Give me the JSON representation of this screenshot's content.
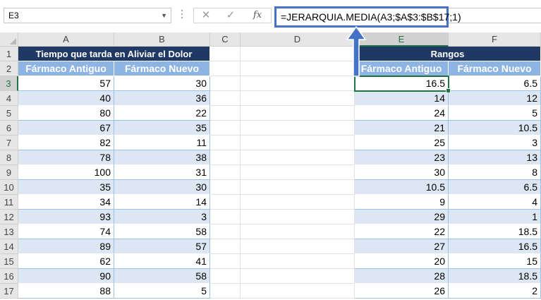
{
  "name_box": "E3",
  "formula": "=JERARQUIA.MEDIA(A3;$A$3:$B$17;1)",
  "formula_bar_icons": [
    "cancel-icon",
    "check-icon",
    "fx-icon"
  ],
  "fx_label": "fx",
  "cancel_glyph": "✕",
  "check_glyph": "✓",
  "columns": [
    "A",
    "B",
    "C",
    "D",
    "E",
    "F"
  ],
  "rows": [
    "1",
    "2",
    "3",
    "4",
    "5",
    "6",
    "7",
    "8",
    "9",
    "10",
    "11",
    "12",
    "13",
    "14",
    "15",
    "16",
    "17"
  ],
  "selected_cell": "E3",
  "left_table": {
    "title": "Tiempo que tarda en Aliviar el Dolor",
    "headers": [
      "Fármaco Antiguo",
      "Fármaco Nuevo"
    ],
    "rows": [
      [
        "57",
        "30"
      ],
      [
        "40",
        "36"
      ],
      [
        "80",
        "22"
      ],
      [
        "67",
        "35"
      ],
      [
        "82",
        "11"
      ],
      [
        "78",
        "38"
      ],
      [
        "100",
        "31"
      ],
      [
        "35",
        "30"
      ],
      [
        "34",
        "14"
      ],
      [
        "93",
        "3"
      ],
      [
        "74",
        "58"
      ],
      [
        "89",
        "57"
      ],
      [
        "62",
        "41"
      ],
      [
        "90",
        "58"
      ],
      [
        "88",
        "5"
      ]
    ]
  },
  "right_table": {
    "title": "Rangos",
    "headers": [
      "Fármaco Antiguo",
      "Fármaco Nuevo"
    ],
    "rows": [
      [
        "16.5",
        "6.5"
      ],
      [
        "14",
        "12"
      ],
      [
        "24",
        "5"
      ],
      [
        "21",
        "10.5"
      ],
      [
        "25",
        "3"
      ],
      [
        "23",
        "13"
      ],
      [
        "30",
        "8"
      ],
      [
        "10.5",
        "6.5"
      ],
      [
        "9",
        "4"
      ],
      [
        "29",
        "1"
      ],
      [
        "22",
        "18.5"
      ],
      [
        "27",
        "16.5"
      ],
      [
        "20",
        "15"
      ],
      [
        "28",
        "18.5"
      ],
      [
        "26",
        "2"
      ]
    ]
  },
  "colors": {
    "title_bg": "#1f3864",
    "header_bg": "#8eb4e3",
    "band_bg": "#dde7f3",
    "selection": "#217346",
    "arrow": "#4472c4"
  }
}
